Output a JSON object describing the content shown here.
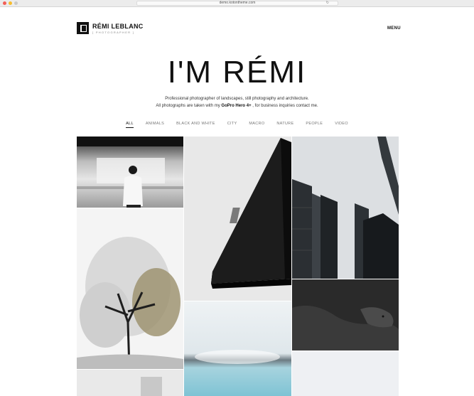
{
  "browser": {
    "url": "demo.kotontheme.com"
  },
  "header": {
    "brand_name": "RÉMI LEBLANC",
    "brand_tagline": "[ PHOTOGRAPHER ]",
    "menu_label": "MENU"
  },
  "hero": {
    "title": "I'M RÉMI",
    "line1": "Professional photographer of landscapes, still photography and architecture.",
    "line2_pre": "All photographs are taken with my",
    "line2_camera": "GoPro Hero 4+",
    "line2_post": ", for business inquiries contact me."
  },
  "filters": [
    "ALL",
    "ANIMALS",
    "BLACK AND WHITE",
    "CITY",
    "MACRO",
    "NATURE",
    "PEOPLE",
    "VIDEO"
  ],
  "active_filter": "ALL",
  "colors": {
    "text": "#111111",
    "muted": "#777777",
    "background": "#ffffff"
  }
}
